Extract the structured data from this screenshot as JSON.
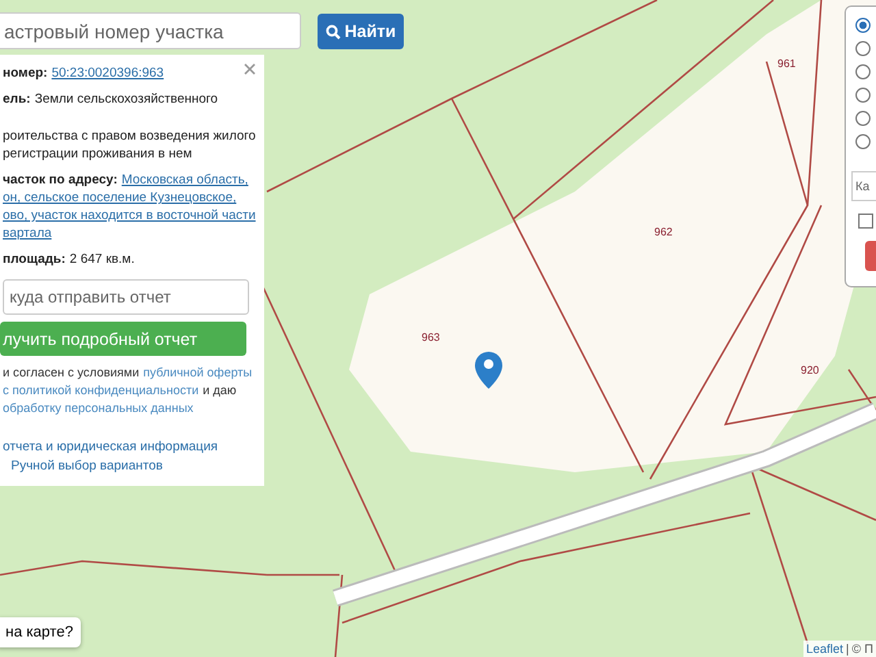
{
  "search": {
    "placeholder": "астровый номер участка",
    "button": "Найти"
  },
  "info_panel": {
    "fields": [
      {
        "kind": "link",
        "label": "номер:",
        "lines": [
          "50:23:0020396:963"
        ]
      },
      {
        "kind": "text",
        "label": "ель:",
        "lines": [
          "Земли сельскохозяйственного"
        ]
      },
      {
        "kind": "text",
        "lines": [
          "роительства с правом возведения жилого",
          "регистрации проживания в нем"
        ]
      },
      {
        "kind": "link",
        "label": "часток по адресу:",
        "lines": [
          "Московская область,",
          "он, сельское поселение Кузнецовское,",
          "ово, участок находится в восточной части",
          "вартала"
        ]
      },
      {
        "kind": "text",
        "label": "площадь:",
        "lines": [
          "2 647 кв.м."
        ]
      }
    ],
    "email_placeholder": "куда отправить отчет",
    "report_button": "лучить подробный отчет",
    "consent": [
      [
        {
          "text": "и согласен с условиями",
          "link": false
        },
        {
          "text": "публичной оферты",
          "link": true
        }
      ],
      [
        {
          "text": "с политикой конфиденциальности",
          "link": true
        },
        {
          "text": "и даю",
          "link": false
        }
      ],
      [
        {
          "text": "обработку персональных данных",
          "link": true
        }
      ]
    ],
    "links": [
      "отчета и юридическая информация",
      "Ручной выбор вариантов"
    ]
  },
  "map": {
    "plot_labels": [
      "961",
      "962",
      "963",
      "920"
    ]
  },
  "map_button": "на карте?",
  "attribution": {
    "link": "Leaflet",
    "separator": "|",
    "text": "© П"
  },
  "layer_panel": {
    "radios": [
      {
        "selected": true
      },
      {
        "selected": false
      },
      {
        "selected": false
      },
      {
        "selected": false
      },
      {
        "selected": false
      },
      {
        "selected": false
      }
    ],
    "field_placeholder": "Ка",
    "checkbox": {
      "checked": false
    }
  }
}
